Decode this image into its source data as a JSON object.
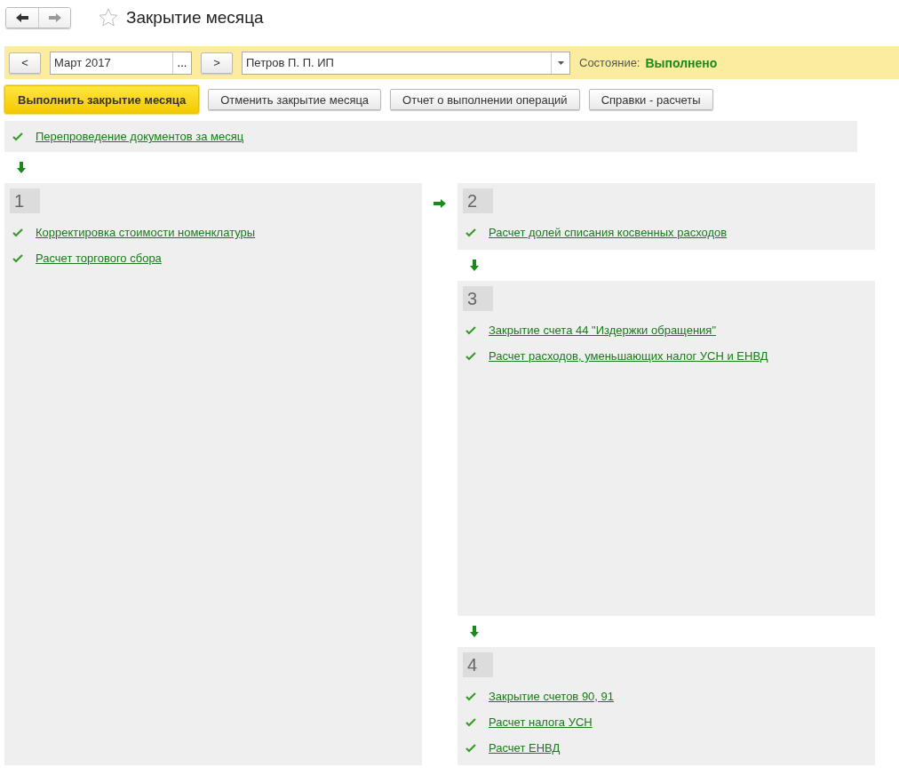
{
  "window": {
    "title": "Закрытие месяца",
    "favorite": false
  },
  "filter": {
    "prev": "<",
    "period": "Март 2017",
    "period_button": "...",
    "next": ">",
    "organization": "Петров П. П. ИП",
    "status_label": "Состояние:",
    "status": "Выполнено"
  },
  "buttons": [
    {
      "label": "Выполнить закрытие месяца",
      "kind": "primary"
    },
    {
      "label": "Отменить закрытие месяца",
      "kind": "normal"
    },
    {
      "label": "Отчет о выполнении операций",
      "kind": "normal"
    },
    {
      "label": "Справки - расчеты",
      "kind": "normal"
    }
  ],
  "preliminary": [
    {
      "label": "Перепроведение документов за месяц",
      "done": true
    }
  ],
  "stages": [
    {
      "number": "1",
      "items": [
        {
          "label": "Корректировка стоимости номенклатуры",
          "done": true
        },
        {
          "label": "Расчет торгового сбора",
          "done": true
        }
      ]
    },
    {
      "number": "2",
      "items": [
        {
          "label": "Расчет долей списания косвенных расходов",
          "done": true
        }
      ]
    },
    {
      "number": "3",
      "items": [
        {
          "label": "Закрытие счета 44 \"Издержки обращения\"",
          "done": true
        },
        {
          "label": "Расчет расходов, уменьшающих налог УСН и ЕНВД",
          "done": true
        }
      ]
    },
    {
      "number": "4",
      "items": [
        {
          "label": "Закрытие счетов 90, 91",
          "done": true
        },
        {
          "label": "Расчет налога УСН",
          "done": true
        },
        {
          "label": "Расчет ЕНВД",
          "done": true
        }
      ]
    }
  ]
}
